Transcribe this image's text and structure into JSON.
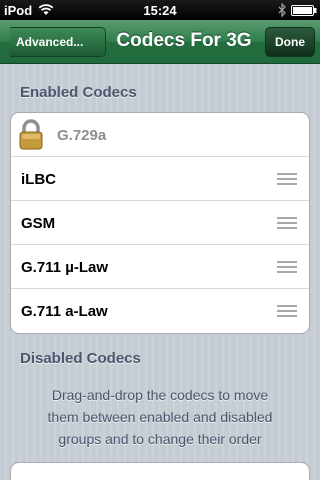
{
  "status_bar": {
    "carrier": "iPod",
    "time": "15:24"
  },
  "nav_bar": {
    "back_label": "Advanced...",
    "title": "Codecs For 3G",
    "done_label": "Done"
  },
  "enabled_section": {
    "header": "Enabled Codecs",
    "items": [
      {
        "label": "G.729a",
        "locked": true
      },
      {
        "label": "iLBC",
        "locked": false
      },
      {
        "label": "GSM",
        "locked": false
      },
      {
        "label": "G.711 µ-Law",
        "locked": false
      },
      {
        "label": "G.711 a-Law",
        "locked": false
      }
    ]
  },
  "disabled_section": {
    "header": "Disabled Codecs",
    "help_lines": [
      "Drag-and-drop the codecs to move",
      "them between enabled and disabled",
      "groups and to change their order"
    ]
  },
  "colors": {
    "nav_green": "#2f7e4c",
    "background": "#c5ccd4",
    "header_text": "#4c566c"
  }
}
